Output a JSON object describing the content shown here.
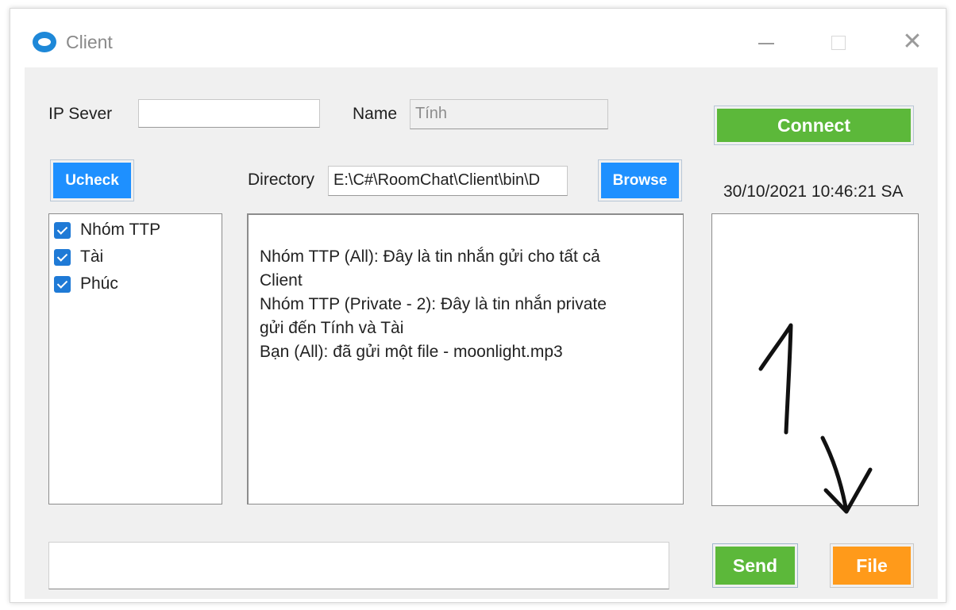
{
  "window": {
    "title": "Client",
    "icon": "chat-bubble-icon"
  },
  "titlebar_buttons": {
    "minimize": "—",
    "maximize": "☐",
    "close": "✕"
  },
  "server": {
    "ip_label": "IP Sever",
    "ip_value": "",
    "name_label": "Name",
    "name_value": "Tính"
  },
  "connect": {
    "label": "Connect",
    "color": "#5cb83a"
  },
  "ucheck": {
    "label": "Ucheck",
    "color": "#1e90ff"
  },
  "directory": {
    "label": "Directory",
    "value": "E:\\C#\\RoomChat\\Client\\bin\\D"
  },
  "browse": {
    "label": "Browse",
    "color": "#1e90ff"
  },
  "timestamp": "30/10/2021 10:46:21 SA",
  "clients": [
    {
      "label": "Nhóm TTP",
      "checked": true
    },
    {
      "label": "Tài",
      "checked": true
    },
    {
      "label": "Phúc",
      "checked": true
    }
  ],
  "messages": [
    "Nhóm TTP (All): Đây là tin nhắn gửi cho tất cả",
    "Client",
    "Nhóm TTP (Private - 2): Đây là tin nhắn private",
    "gửi đến Tính và Tài",
    "Bạn (All): đã gửi một file - moonlight.mp3"
  ],
  "message_input": {
    "value": ""
  },
  "send": {
    "label": "Send",
    "color": "#5cb83a"
  },
  "file": {
    "label": "File",
    "color": "#ff9a1a"
  }
}
